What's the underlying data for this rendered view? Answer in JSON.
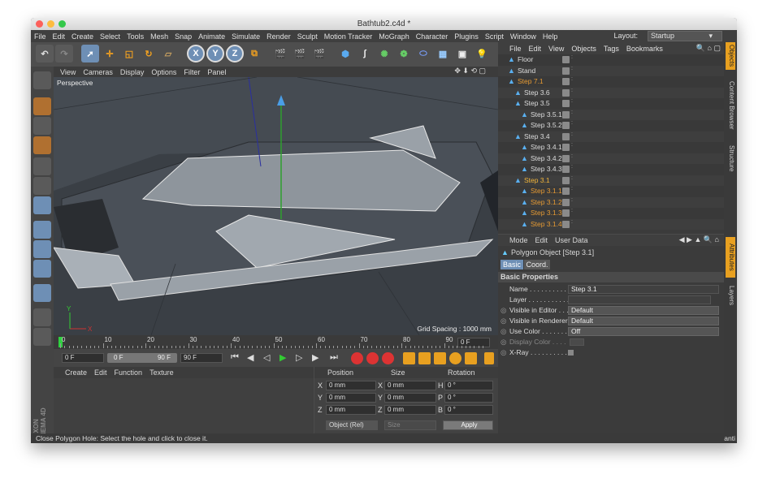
{
  "window": {
    "title": "Bathtub2.c4d *"
  },
  "menubar": {
    "items": [
      "File",
      "Edit",
      "Create",
      "Select",
      "Tools",
      "Mesh",
      "Snap",
      "Animate",
      "Simulate",
      "Render",
      "Sculpt",
      "Motion Tracker",
      "MoGraph",
      "Character",
      "Plugins",
      "Script",
      "Window",
      "Help"
    ],
    "layout_label": "Layout:",
    "layout_value": "Startup"
  },
  "viewport": {
    "menu": [
      "View",
      "Cameras",
      "Display",
      "Options",
      "Filter",
      "Panel"
    ],
    "camera_label": "Perspective",
    "grid_spacing": "Grid Spacing : 1000 mm"
  },
  "timeline": {
    "ticks": [
      "0",
      "10",
      "20",
      "30",
      "40",
      "50",
      "60",
      "70",
      "80",
      "90"
    ],
    "current": "0 F"
  },
  "transport": {
    "start": "0 F",
    "range_start": "0 F",
    "range_end": "90 F",
    "end": "90 F"
  },
  "material": {
    "menu": [
      "Create",
      "Edit",
      "Function",
      "Texture"
    ]
  },
  "coords": {
    "headers": [
      "Position",
      "Size",
      "Rotation"
    ],
    "rows": [
      {
        "axis": "X",
        "pos": "0 mm",
        "size_axis": "X",
        "size": "0 mm",
        "rot_axis": "H",
        "rot": "0 °"
      },
      {
        "axis": "Y",
        "pos": "0 mm",
        "size_axis": "Y",
        "size": "0 mm",
        "rot_axis": "P",
        "rot": "0 °"
      },
      {
        "axis": "Z",
        "pos": "0 mm",
        "size_axis": "Z",
        "size": "0 mm",
        "rot_axis": "B",
        "rot": "0 °"
      }
    ],
    "mode": "Object (Rel)",
    "size_mode": "Size",
    "apply": "Apply"
  },
  "status": {
    "text": "Close Polygon Hole: Select the hole and click to close it."
  },
  "objects": {
    "menu": [
      "File",
      "Edit",
      "View",
      "Objects",
      "Tags",
      "Bookmarks"
    ],
    "rows": [
      {
        "name": "Floor",
        "indent": 0,
        "color": "#dcdcdc"
      },
      {
        "name": "Stand",
        "indent": 0,
        "color": "#dcdcdc"
      },
      {
        "name": "Step 7.1",
        "indent": 0,
        "color": "#e69a33"
      },
      {
        "name": "Step 3.6",
        "indent": 1,
        "color": "#dcdcdc"
      },
      {
        "name": "Step 3.5",
        "indent": 1,
        "color": "#dcdcdc"
      },
      {
        "name": "Step 3.5.1",
        "indent": 2,
        "color": "#dcdcdc"
      },
      {
        "name": "Step 3.5.2",
        "indent": 2,
        "color": "#dcdcdc"
      },
      {
        "name": "Step 3.4",
        "indent": 1,
        "color": "#dcdcdc"
      },
      {
        "name": "Step 3.4.1",
        "indent": 2,
        "color": "#dcdcdc"
      },
      {
        "name": "Step 3.4.2",
        "indent": 2,
        "color": "#dcdcdc"
      },
      {
        "name": "Step 3.4.3",
        "indent": 2,
        "color": "#dcdcdc"
      },
      {
        "name": "Step 3.1",
        "indent": 1,
        "color": "#f2b53a"
      },
      {
        "name": "Step 3.1.1",
        "indent": 2,
        "color": "#e69a33"
      },
      {
        "name": "Step 3.1.2",
        "indent": 2,
        "color": "#e69a33"
      },
      {
        "name": "Step 3.1.3",
        "indent": 2,
        "color": "#e69a33"
      },
      {
        "name": "Step 3.1.4",
        "indent": 2,
        "color": "#e69a33"
      }
    ]
  },
  "attributes": {
    "menu": [
      "Mode",
      "Edit",
      "User Data"
    ],
    "object_title": "Polygon Object [Step 3.1]",
    "tabs": [
      "Basic",
      "Coord."
    ],
    "section": "Basic Properties",
    "props": [
      {
        "label": "Name . . . . . . . . . . . . .",
        "value": "Step 3.1"
      },
      {
        "label": "Layer . . . . . . . . . . . .",
        "value": ""
      },
      {
        "label": "Visible in Editor . . .",
        "value": "Default"
      },
      {
        "label": "Visible in Renderer",
        "value": "Default"
      },
      {
        "label": "Use Color . . . . . . . .",
        "value": "Off"
      },
      {
        "label": "Display Color . . . .",
        "value": ""
      },
      {
        "label": "X-Ray . . . . . . . . . . .",
        "value": ""
      }
    ]
  },
  "side_tabs": [
    "Objects",
    "Content Browser",
    "Structure",
    "Attributes",
    "Layers"
  ],
  "status_right": "anti"
}
